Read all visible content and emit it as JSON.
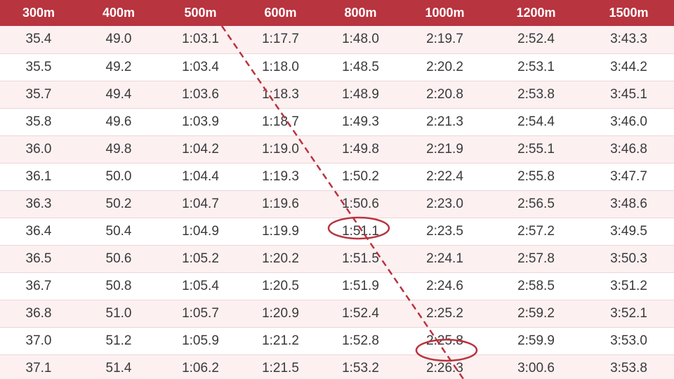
{
  "table": {
    "headers": [
      "300m",
      "400m",
      "500m",
      "600m",
      "800m",
      "1000m",
      "1200m",
      "1500m"
    ],
    "rows": [
      [
        "35.4",
        "49.0",
        "1:03.1",
        "1:17.7",
        "1:48.0",
        "2:19.7",
        "2:52.4",
        "3:43.3"
      ],
      [
        "35.5",
        "49.2",
        "1:03.4",
        "1:18.0",
        "1:48.5",
        "2:20.2",
        "2:53.1",
        "3:44.2"
      ],
      [
        "35.7",
        "49.4",
        "1:03.6",
        "1:18.3",
        "1:48.9",
        "2:20.8",
        "2:53.8",
        "3:45.1"
      ],
      [
        "35.8",
        "49.6",
        "1:03.9",
        "1:18.7",
        "1:49.3",
        "2:21.3",
        "2:54.4",
        "3:46.0"
      ],
      [
        "36.0",
        "49.8",
        "1:04.2",
        "1:19.0",
        "1:49.8",
        "2:21.9",
        "2:55.1",
        "3:46.8"
      ],
      [
        "36.1",
        "50.0",
        "1:04.4",
        "1:19.3",
        "1:50.2",
        "2:22.4",
        "2:55.8",
        "3:47.7"
      ],
      [
        "36.3",
        "50.2",
        "1:04.7",
        "1:19.6",
        "1:50.6",
        "2:23.0",
        "2:56.5",
        "3:48.6"
      ],
      [
        "36.4",
        "50.4",
        "1:04.9",
        "1:19.9",
        "1:51.1",
        "2:23.5",
        "2:57.2",
        "3:49.5"
      ],
      [
        "36.5",
        "50.6",
        "1:05.2",
        "1:20.2",
        "1:51.5",
        "2:24.1",
        "2:57.8",
        "3:50.3"
      ],
      [
        "36.7",
        "50.8",
        "1:05.4",
        "1:20.5",
        "1:51.9",
        "2:24.6",
        "2:58.5",
        "3:51.2"
      ],
      [
        "36.8",
        "51.0",
        "1:05.7",
        "1:20.9",
        "1:52.4",
        "2:25.2",
        "2:59.2",
        "3:52.1"
      ],
      [
        "37.0",
        "51.2",
        "1:05.9",
        "1:21.2",
        "1:52.8",
        "2:25.8",
        "2:59.9",
        "3:53.0"
      ],
      [
        "37.1",
        "51.4",
        "1:06.2",
        "1:21.5",
        "1:53.2",
        "2:26.3",
        "3:00.6",
        "3:53.8"
      ]
    ]
  },
  "annotations": {
    "highlighted_cells": [
      "1:51.1",
      "2:25.8"
    ],
    "trend_line": "dashed"
  },
  "colors": {
    "header_background": "#b8343f",
    "header_text": "#ffffff",
    "row_alt_background": "#fdf0f1",
    "row_background": "#ffffff",
    "cell_text": "#3a3a3a",
    "annotation": "#b8343f"
  }
}
